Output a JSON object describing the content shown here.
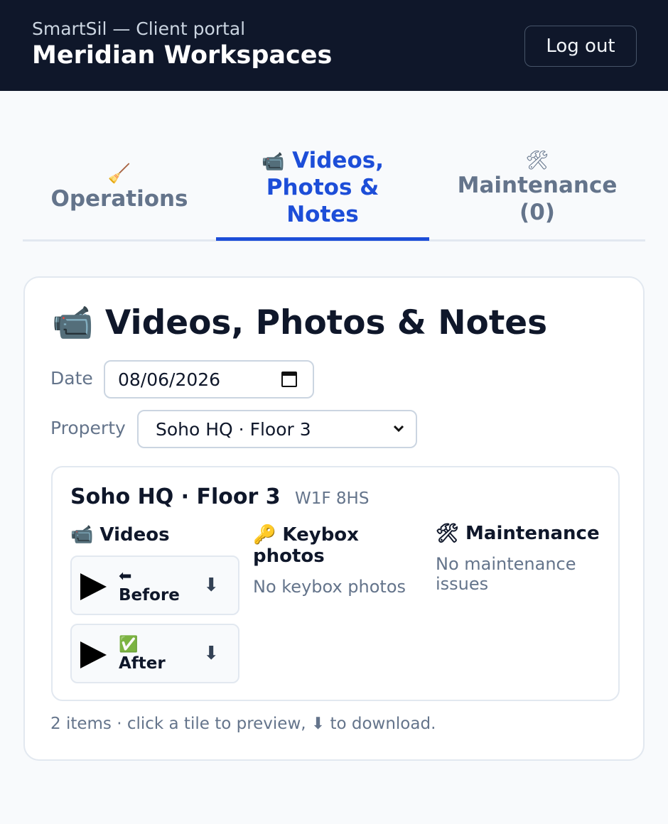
{
  "header": {
    "subtitle": "SmartSil — Client portal",
    "title": "Meridian Workspaces",
    "logout_label": "Log out"
  },
  "tabs": [
    {
      "icon": "🧹",
      "label": "Operations",
      "active": false
    },
    {
      "icon": "📹",
      "label": "Videos, Photos & Notes",
      "active": true
    },
    {
      "icon": "🛠",
      "label": "Maintenance (0)",
      "active": false
    }
  ],
  "panel": {
    "title_icon": "📹",
    "title": "Videos, Photos & Notes",
    "date_label": "Date",
    "date_value": "08/06/2026",
    "property_label": "Property",
    "property_value": "Soho HQ · Floor 3",
    "property_card": {
      "name": "Soho HQ · Floor 3",
      "postcode": "W1F 8HS",
      "videos_heading": "📹 Videos",
      "videos": [
        {
          "icon": "⬅",
          "label": "Before",
          "download": "⬇"
        },
        {
          "icon": "✅",
          "label": "After",
          "download": "⬇"
        }
      ],
      "keybox_heading": "🔑 Keybox photos",
      "keybox_empty": "No keybox photos",
      "maintenance_heading": "🛠 Maintenance",
      "maintenance_empty": "No maintenance issues"
    },
    "footer": "2 items · click a tile to preview, ⬇ to download."
  },
  "colors": {
    "header_bg": "#0f172a",
    "accent": "#1d4ed8",
    "muted": "#64748b",
    "border": "#e2e8f0"
  }
}
